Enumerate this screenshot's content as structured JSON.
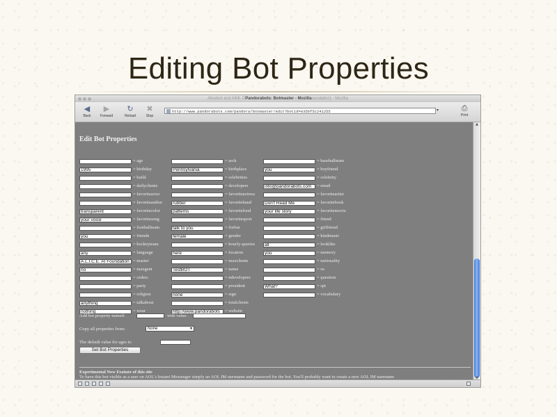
{
  "slide": {
    "title": "Editing Bot Properties"
  },
  "window": {
    "title_pre": "Alicebot and AIML D",
    "title_main": "Pandorabots: Botmaster - Mozilla",
    "title_post": "oundation) - Mozilla"
  },
  "toolbar": {
    "back": "Back",
    "forward": "Forward",
    "reload": "Reload",
    "stop": "Stop",
    "print": "Print",
    "url": "http://www.pandorabots.com/pandora/botmaster/edit?botid=e35bf5c241255"
  },
  "page": {
    "heading": "Edit Bot Properties",
    "columns": [
      [
        {
          "label": "= age",
          "value": ""
        },
        {
          "label": "= birthday",
          "value": "1995"
        },
        {
          "label": "= build",
          "value": ""
        },
        {
          "label": "= dailyclients",
          "value": ""
        },
        {
          "label": "= favoriteactor",
          "value": ""
        },
        {
          "label": "= favoriteauthor",
          "value": ""
        },
        {
          "label": "= favoritecolor",
          "value": "transparent"
        },
        {
          "label": "= favoritesong",
          "value": "your voice"
        },
        {
          "label": "= footballteam",
          "value": ""
        },
        {
          "label": "= friends",
          "value": "you"
        },
        {
          "label": "= hockeyteam",
          "value": ""
        },
        {
          "label": "= language",
          "value": "any"
        },
        {
          "label": "= master",
          "value": "A.L.I.C.E. AI Foundation"
        },
        {
          "label": "= maxgent",
          "value": "no"
        },
        {
          "label": "= orders",
          "value": ""
        },
        {
          "label": "= party",
          "value": ""
        },
        {
          "label": "= religion",
          "value": ""
        },
        {
          "label": "= talkabout",
          "value": "anything"
        },
        {
          "label": "= wear",
          "value": "nothing"
        }
      ],
      [
        {
          "label": "= arch",
          "value": ""
        },
        {
          "label": "= birthplace",
          "value": "Pennsylvania"
        },
        {
          "label": "= celebrities",
          "value": ""
        },
        {
          "label": "= developers",
          "value": ""
        },
        {
          "label": "= favoriteactress",
          "value": ""
        },
        {
          "label": "= favoriteband",
          "value": "rubber"
        },
        {
          "label": "= favoritefood",
          "value": "patterns"
        },
        {
          "label": "= favoritesport",
          "value": ""
        },
        {
          "label": "= forfun",
          "value": "talk to you"
        },
        {
          "label": "= gender",
          "value": "female"
        },
        {
          "label": "= hourly-queries",
          "value": ""
        },
        {
          "label": "= location",
          "value": "here"
        },
        {
          "label": "= maxclients",
          "value": ""
        },
        {
          "label": "= name",
          "value": "TestBOT"
        },
        {
          "label": "= ndevelopers",
          "value": ""
        },
        {
          "label": "= president",
          "value": ""
        },
        {
          "label": "= sign",
          "value": "none"
        },
        {
          "label": "= totalclients",
          "value": ""
        },
        {
          "label": "= website",
          "value": "http://www.pandorabots"
        }
      ],
      [
        {
          "label": "= baseballteam",
          "value": ""
        },
        {
          "label": "= boyfriend",
          "value": "you"
        },
        {
          "label": "= celebrity",
          "value": ""
        },
        {
          "label": "= email",
          "value": "info@pandorabots.com"
        },
        {
          "label": "= favoriteartist",
          "value": ""
        },
        {
          "label": "= favoritebook",
          "value": "Don't Read Me"
        },
        {
          "label": "= favoritemovie",
          "value": "your life story"
        },
        {
          "label": "= friend",
          "value": ""
        },
        {
          "label": "= girlfriend",
          "value": ""
        },
        {
          "label": "= kindmusic",
          "value": ""
        },
        {
          "label": "= looklike",
          "value": "all"
        },
        {
          "label": "= memory",
          "value": "you"
        },
        {
          "label": "= nationality",
          "value": ""
        },
        {
          "label": "= os",
          "value": ""
        },
        {
          "label": "= question",
          "value": ""
        },
        {
          "label": "= spt",
          "value": "What?"
        },
        {
          "label": "= vocabulary",
          "value": ""
        },
        {
          "label": "",
          "value": ""
        },
        {
          "label": "",
          "value": ""
        }
      ]
    ],
    "add_named": "Add bot property named:",
    "with_value": "with value:",
    "copy_from": "Copy all properties from:",
    "copy_select": "None",
    "default_value": "The default value for ages is:",
    "set_button": "Set Bot Properties",
    "experimental_title": "Experimental New Feature of this site",
    "experimental_text": "To have this bot visible as a user on AOL's Instant Messenger simply an AOL IM username and password for the bot. You'll probably want to create a new AOL IM username"
  }
}
